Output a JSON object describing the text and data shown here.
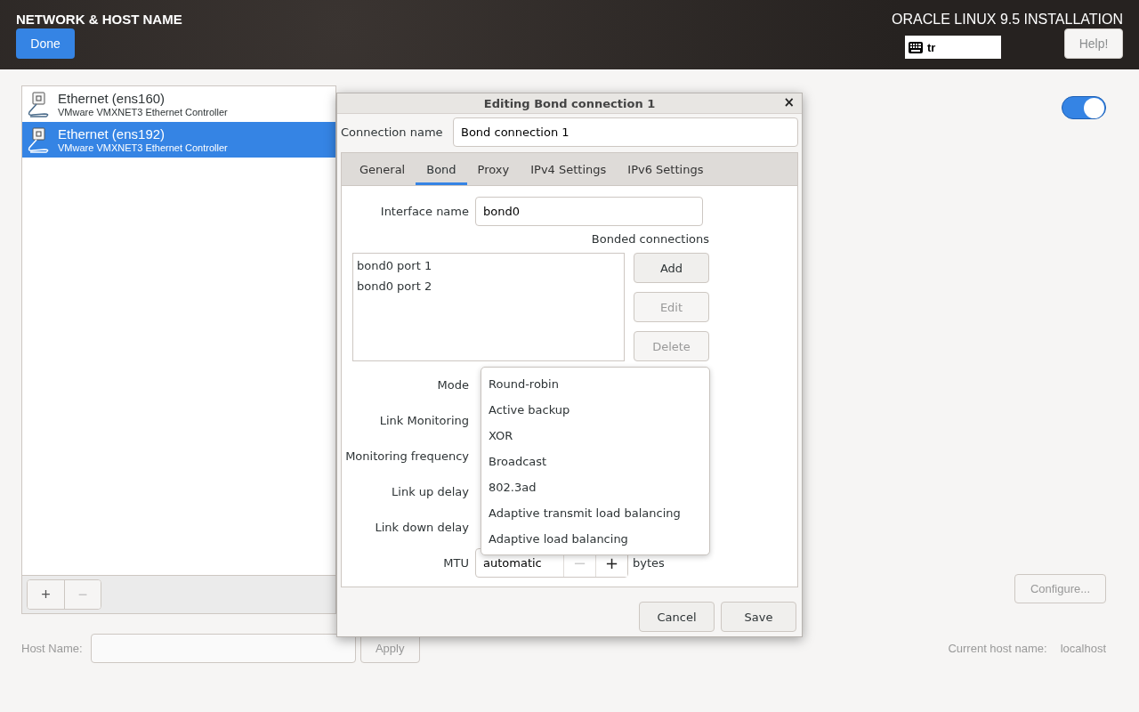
{
  "header": {
    "title": "NETWORK & HOST NAME",
    "done_button": "Done",
    "product": "ORACLE LINUX 9.5 INSTALLATION",
    "keyboard_layout": "tr",
    "help_button": "Help!"
  },
  "devices": [
    {
      "name": "Ethernet (ens160)",
      "description": "VMware VMXNET3 Ethernet Controller",
      "selected": false
    },
    {
      "name": "Ethernet (ens192)",
      "description": "VMware VMXNET3 Ethernet Controller",
      "selected": true
    }
  ],
  "device_toolbar": [
    {
      "label": "+",
      "disabled": false
    },
    {
      "label": "−",
      "disabled": true
    }
  ],
  "device_switch": {
    "on": true
  },
  "configure_button": {
    "label": "Configure...",
    "disabled": true
  },
  "host_name": {
    "label": "Host Name:",
    "apply_button": "Apply",
    "current_label": "Current host name:",
    "current_value": "localhost"
  },
  "dialog": {
    "title": "Editing Bond connection 1",
    "close": "×",
    "connection_name_label": "Connection name",
    "connection_name": "Bond connection 1",
    "tabs": [
      {
        "label": "General",
        "selected": false
      },
      {
        "label": "Bond",
        "selected": true
      },
      {
        "label": "Proxy",
        "selected": false
      },
      {
        "label": "IPv4 Settings",
        "selected": false
      },
      {
        "label": "IPv6 Settings",
        "selected": false
      }
    ],
    "interface_name_label": "Interface name",
    "interface_name": "bond0",
    "bonded_label": "Bonded connections",
    "bonded_connections": [
      {
        "name": "bond0 port 1",
        "selected": false
      },
      {
        "name": "bond0 port 2",
        "selected": false
      }
    ],
    "list_buttons": [
      {
        "label": "Add",
        "disabled": false
      },
      {
        "label": "Edit",
        "disabled": true
      },
      {
        "label": "Delete",
        "disabled": true
      }
    ],
    "fields": [
      {
        "label": "Mode"
      },
      {
        "label": "Link Monitoring"
      },
      {
        "label": "Monitoring frequency"
      },
      {
        "label": "Link up delay"
      },
      {
        "label": "Link down delay"
      }
    ],
    "mtu": {
      "label": "MTU",
      "value": "automatic",
      "minus": "−",
      "plus": "+",
      "unit": "bytes",
      "minus_disabled": true
    },
    "mode_menu": [
      {
        "label": "Round-robin",
        "selected": false
      },
      {
        "label": "Active backup",
        "selected": false
      },
      {
        "label": "XOR",
        "selected": false
      },
      {
        "label": "Broadcast",
        "selected": false
      },
      {
        "label": "802.3ad",
        "selected": false
      },
      {
        "label": "Adaptive transmit load balancing",
        "selected": false
      },
      {
        "label": "Adaptive load balancing",
        "selected": false
      }
    ],
    "buttons": [
      "Cancel",
      "Save"
    ]
  }
}
